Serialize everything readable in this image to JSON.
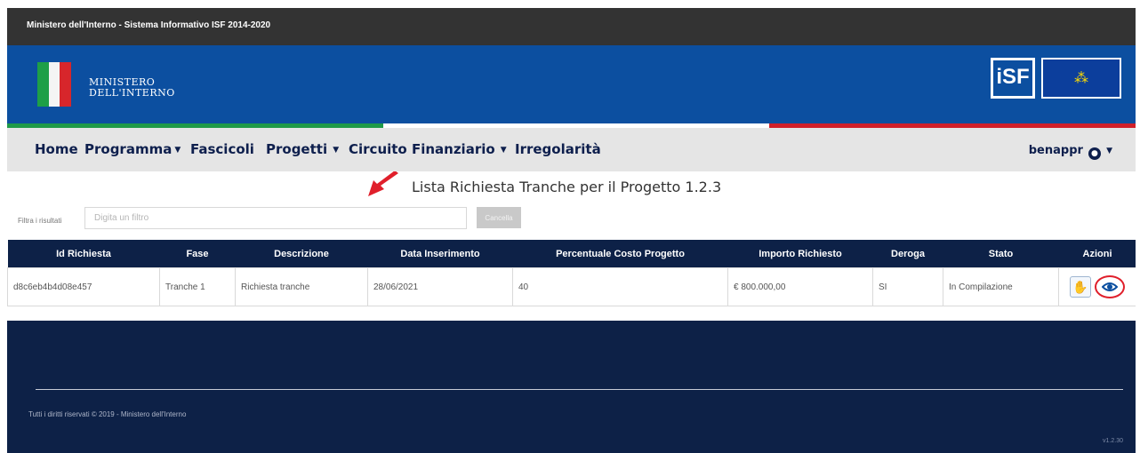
{
  "header": {
    "title": "Ministero dell'Interno - Sistema Informativo ISF 2014-2020",
    "ministry_line1": "MINISTERO",
    "ministry_line2": "DELL'INTERNO",
    "isf_logo_text": "iSF",
    "icons": [
      "italian-flag-icon",
      "isf-logo-icon",
      "eu-flag-icon"
    ]
  },
  "nav": {
    "home": "Home",
    "programma": "Programma",
    "fascicoli": "Fascicoli",
    "progetti": "Progetti",
    "circuito": "Circuito Finanziario",
    "irregolarita": "Irregolarità",
    "user": "benappr"
  },
  "page": {
    "title": "Lista Richiesta Tranche per il Progetto 1.2.3"
  },
  "filter": {
    "label": "Filtra i risultati",
    "placeholder": "Digita un filtro",
    "clear_label": "Cancella"
  },
  "table": {
    "columns": [
      "Id Richiesta",
      "Fase",
      "Descrizione",
      "Data Inserimento",
      "Percentuale Costo Progetto",
      "Importo Richiesto",
      "Deroga",
      "Stato",
      "Azioni"
    ],
    "rows": [
      [
        "d8c6eb4b4d08e457",
        "Tranche 1",
        "Richiesta tranche",
        "28/06/2021",
        "40",
        "€ 800.000,00",
        "SI",
        "In Compilazione"
      ]
    ]
  },
  "footer": {
    "copyright": "Tutti i diritti riservati © 2019 - Ministero dell'Interno",
    "version": "v1.2.30"
  },
  "colors": {
    "topbar": "#333333",
    "banner": "#0c4fa0",
    "nav_text": "#0e1f4d",
    "table_header": "#0d2147",
    "footer": "#0d2147",
    "annotation": "#e01f2b"
  }
}
